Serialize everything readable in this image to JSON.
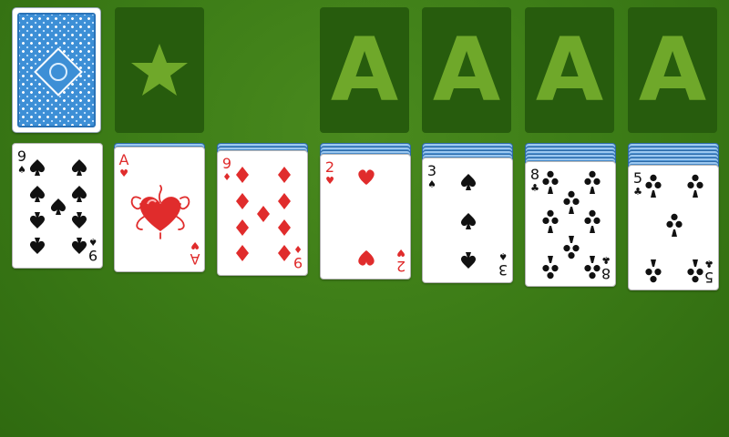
{
  "stock": {
    "state": "face-down",
    "pattern": "blue"
  },
  "waste": {
    "icon": "star-icon",
    "state": "empty"
  },
  "foundations": [
    {
      "label": "A"
    },
    {
      "label": "A"
    },
    {
      "label": "A"
    },
    {
      "label": "A"
    }
  ],
  "tableau": [
    {
      "hidden": 0,
      "card": {
        "rank": "9",
        "suit": "spades",
        "symbol": "♠",
        "color": "black"
      }
    },
    {
      "hidden": 1,
      "card": {
        "rank": "A",
        "suit": "hearts",
        "symbol": "♥",
        "color": "red"
      }
    },
    {
      "hidden": 2,
      "card": {
        "rank": "9",
        "suit": "diamonds",
        "symbol": "♦",
        "color": "red"
      }
    },
    {
      "hidden": 3,
      "card": {
        "rank": "2",
        "suit": "hearts",
        "symbol": "♥",
        "color": "red"
      }
    },
    {
      "hidden": 4,
      "card": {
        "rank": "3",
        "suit": "spades",
        "symbol": "♠",
        "color": "black"
      }
    },
    {
      "hidden": 5,
      "card": {
        "rank": "8",
        "suit": "clubs",
        "symbol": "♣",
        "color": "black"
      }
    },
    {
      "hidden": 6,
      "card": {
        "rank": "5",
        "suit": "clubs",
        "symbol": "♣",
        "color": "black"
      }
    }
  ],
  "colors": {
    "felt": "#3d7d17",
    "slot": "#275c0d",
    "ace_mark": "#6fa82a",
    "card_back": "#3d8fd6",
    "red_suit": "#e02c2c",
    "black_suit": "#111111"
  }
}
